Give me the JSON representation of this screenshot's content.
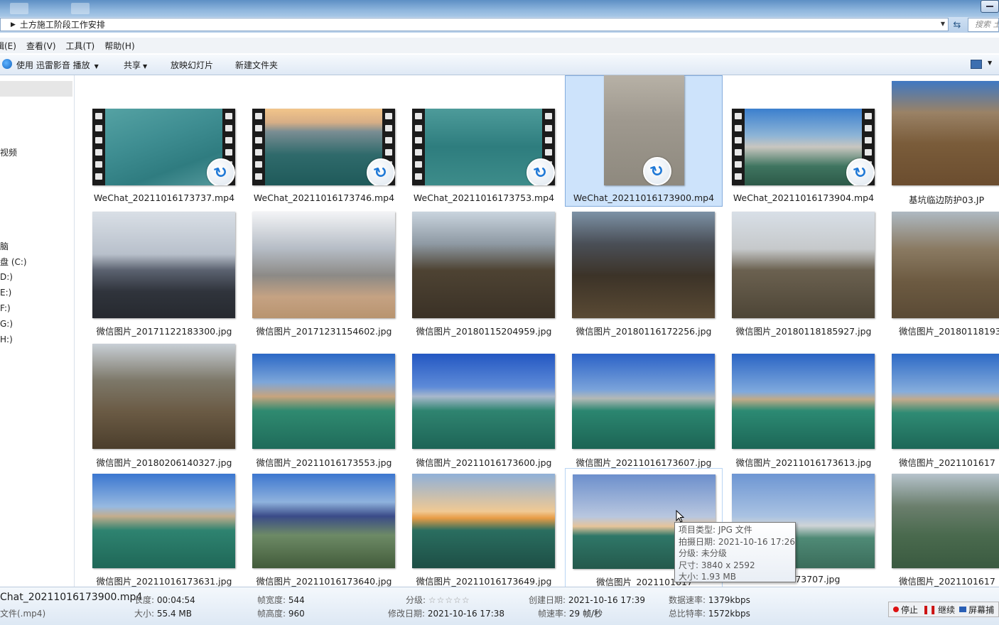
{
  "window": {
    "breadcrumb": [
      "土方施工阶段工作安排"
    ],
    "search_placeholder": "搜索 土"
  },
  "menu": [
    "编辑(E)",
    "查看(V)",
    "工具(T)",
    "帮助(H)"
  ],
  "menu_visible": [
    "辑(E)",
    "查看(V)",
    "工具(T)",
    "帮助(H)"
  ],
  "toolbar": {
    "play_with": "使用 迅雷影音 播放",
    "share": "共享",
    "slideshow": "放映幻灯片",
    "new_folder": "新建文件夹"
  },
  "nav": {
    "items": [
      "视频",
      "脑",
      "盘 (C:)",
      "D:)",
      "E:)",
      "F:)",
      "G:)",
      "H:)"
    ]
  },
  "files": [
    {
      "name": "WeChat_20211016173737.mp4",
      "type": "video"
    },
    {
      "name": "WeChat_20211016173746.mp4",
      "type": "video"
    },
    {
      "name": "WeChat_20211016173753.mp4",
      "type": "video"
    },
    {
      "name": "WeChat_20211016173900.mp4",
      "type": "video",
      "selected": true
    },
    {
      "name": "WeChat_20211016173904.mp4",
      "type": "video"
    },
    {
      "name": "基坑临边防护03.JP",
      "type": "image"
    },
    {
      "name": "微信图片_20171122183300.jpg",
      "type": "image"
    },
    {
      "name": "微信图片_20171231154602.jpg",
      "type": "image"
    },
    {
      "name": "微信图片_20180115204959.jpg",
      "type": "image"
    },
    {
      "name": "微信图片_20180116172256.jpg",
      "type": "image"
    },
    {
      "name": "微信图片_20180118185927.jpg",
      "type": "image"
    },
    {
      "name": "微信图片_20180118193",
      "type": "image"
    },
    {
      "name": "微信图片_20180206140327.jpg",
      "type": "image"
    },
    {
      "name": "微信图片_20211016173553.jpg",
      "type": "image"
    },
    {
      "name": "微信图片_20211016173600.jpg",
      "type": "image"
    },
    {
      "name": "微信图片_20211016173607.jpg",
      "type": "image"
    },
    {
      "name": "微信图片_20211016173613.jpg",
      "type": "image"
    },
    {
      "name": "微信图片_2021101617",
      "type": "image"
    },
    {
      "name": "微信图片_20211016173631.jpg",
      "type": "image"
    },
    {
      "name": "微信图片_20211016173640.jpg",
      "type": "image"
    },
    {
      "name": "微信图片_20211016173649.jpg",
      "type": "image"
    },
    {
      "name": "微信图片_2021101617",
      "type": "image",
      "hovered": true
    },
    {
      "name": "1016173707.jpg",
      "type": "image"
    },
    {
      "name": "微信图片_2021101617",
      "type": "image"
    }
  ],
  "tooltip": {
    "lines": [
      "项目类型: JPG 文件",
      "拍摄日期: 2021-10-16 17:26",
      "分级: 未分级",
      "尺寸: 3840 x 2592",
      "大小: 1.93 MB"
    ]
  },
  "details": {
    "filename": "Chat_20211016173900.mp4",
    "filetype": "文件(.mp4)",
    "length_label": "长度:",
    "length": "00:04:54",
    "size_label": "大小:",
    "size": "55.4 MB",
    "frame_width_label": "帧宽度:",
    "frame_width": "544",
    "frame_height_label": "帧高度:",
    "frame_height": "960",
    "rating_label": "分级:",
    "rating_stars": "☆☆☆☆☆",
    "modified_label": "修改日期:",
    "modified": "2021-10-16 17:38",
    "created_label": "创建日期:",
    "created": "2021-10-16 17:39",
    "framerate_label": "帧速率:",
    "framerate": "29 帧/秒",
    "datarate_label": "数据速率:",
    "datarate": "1379kbps",
    "bitrate_label": "总比特率:",
    "bitrate": "1572kbps"
  },
  "recorder": {
    "stop": "停止",
    "resume": "继续",
    "screen": "屏幕捕"
  }
}
